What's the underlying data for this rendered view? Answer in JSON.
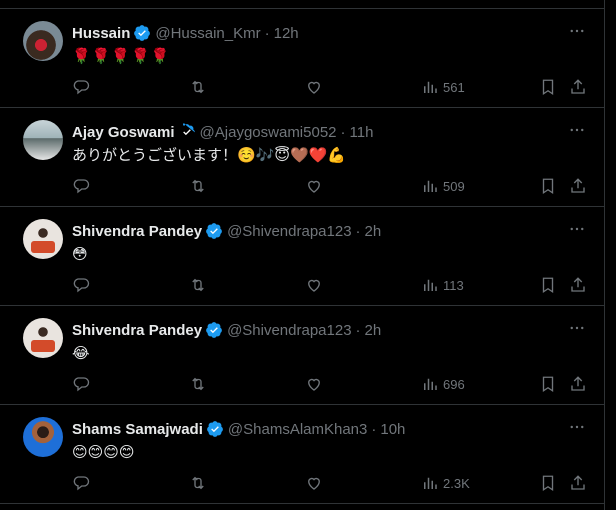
{
  "colors": {
    "accent": "#1d9bf0",
    "muted": "#71767b",
    "text": "#e7e9ea",
    "divider": "#2f3336"
  },
  "tweets": [
    {
      "name": "Hussain",
      "handle": "@Hussain_Kmr",
      "time": "12h",
      "text": "🌹🌹🌹🌹🌹",
      "views": "561",
      "avatar": "rose-avatar"
    },
    {
      "name": "Ajay Goswami",
      "handle": "@Ajaygoswami5052",
      "time": "11h",
      "text": "ありがとうございます！☺️🎶😇🤎❤️💪",
      "views": "509",
      "avatar": "photo-avatar"
    },
    {
      "name": "Shivendra Pandey",
      "handle": "@Shivendrapa123",
      "time": "2h",
      "text": "😳",
      "views": "113",
      "avatar": "photo-avatar"
    },
    {
      "name": "Shivendra Pandey",
      "handle": "@Shivendrapa123",
      "time": "2h",
      "text": "😂",
      "views": "696",
      "avatar": "photo-avatar"
    },
    {
      "name": "Shams Samajwadi",
      "handle": "@ShamsAlamKhan3",
      "time": "10h",
      "text": "😊😊😊😊",
      "views": "2.3K",
      "avatar": "photo-avatar"
    }
  ],
  "icons": {
    "verified": "verified-badge-icon",
    "more": "more-icon",
    "reply": "reply-icon",
    "retweet": "retweet-icon",
    "like": "like-icon",
    "views": "views-icon",
    "bookmark": "bookmark-icon",
    "share": "share-icon"
  }
}
